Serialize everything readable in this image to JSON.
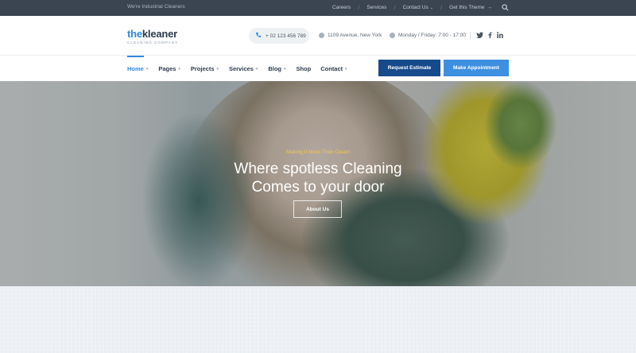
{
  "topbar": {
    "tagline": "We're Industrial Cleaners",
    "links": [
      "Careers",
      "Services",
      "Contact Us",
      "Get this Theme"
    ],
    "contact_caret": "⌄",
    "theme_arrow": "→",
    "search_icon": "search-icon"
  },
  "header": {
    "logo": {
      "the": "the",
      "kleaner": "kleaner",
      "sub": "CLEANING COMPANY"
    },
    "phone": "+ 02 123 456 789",
    "address": "1109 Avenue, New York",
    "hours": "Monday / Friday: 7:00 - 17:00",
    "social": [
      "twitter-icon",
      "facebook-icon",
      "linkedin-icon"
    ]
  },
  "nav": {
    "items": [
      "Home",
      "Pages",
      "Projects",
      "Services",
      "Blog",
      "Shop",
      "Contact"
    ],
    "active": "Home",
    "request_estimate": "Request Estimate",
    "make_appointment": "Make Appointment"
  },
  "hero": {
    "eyebrow": "Making It More Than Clean!",
    "headline_line1": "Where spotless Cleaning",
    "headline_line2": "Comes to your door",
    "about_button": "About Us"
  },
  "colors": {
    "accent": "#2f8ae0",
    "dark_button": "#174a8c",
    "topbar": "#3b4451",
    "eyebrow": "#f3c846"
  }
}
